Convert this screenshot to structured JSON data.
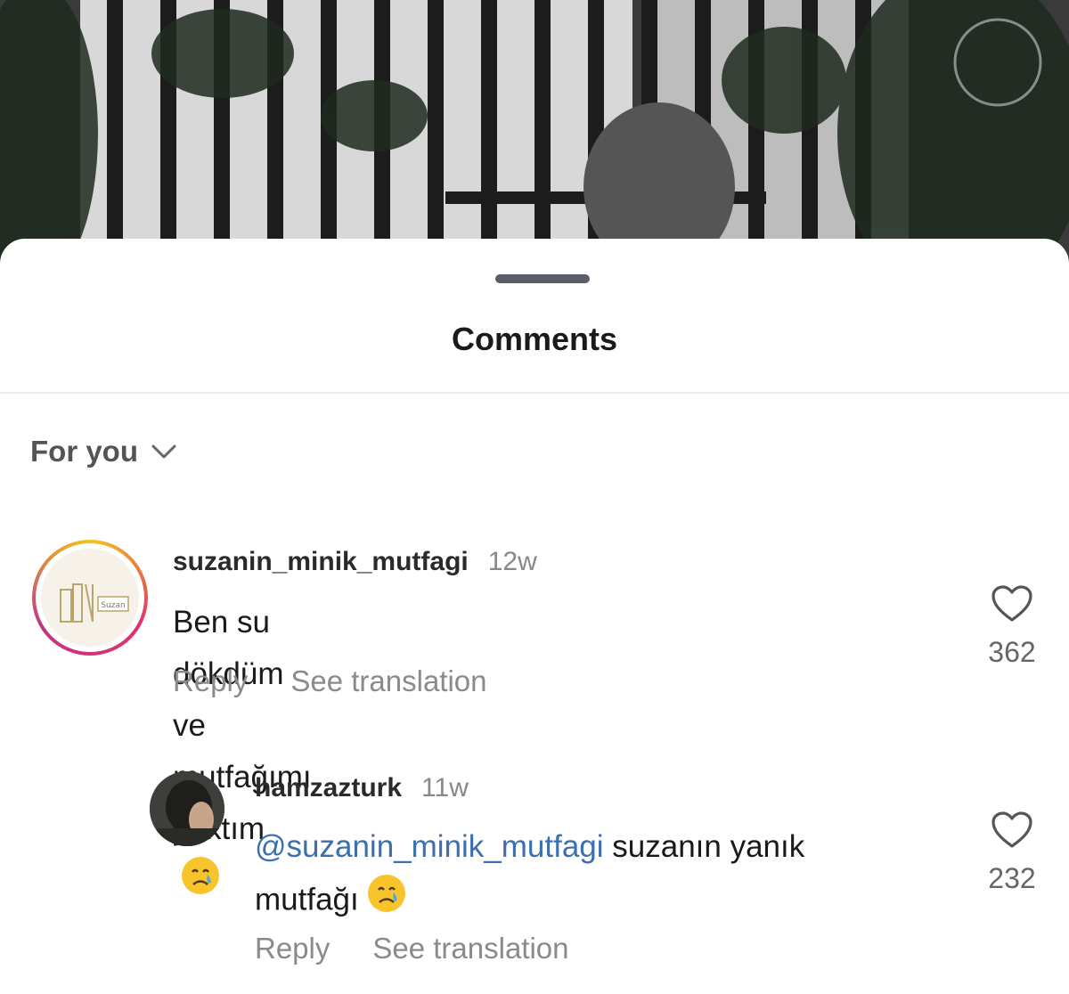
{
  "sheet": {
    "title": "Comments",
    "sort_label": "For you"
  },
  "comments": [
    {
      "username": "suzanin_minik_mutfagi",
      "time": "12w",
      "text": "Ben su dökdüm ve mutfağımı yaktım",
      "emoji": "crying-face",
      "reply_label": "Reply",
      "translate_label": "See translation",
      "likes": "362",
      "avatar_text": "Suzan"
    },
    {
      "username": "hamzazturk",
      "time": "11w",
      "mention": "@suzanin_minik_mutfagi",
      "text_line1": "suzanın yanık",
      "text_line2": "mutfağı",
      "emoji": "crying-face",
      "reply_label": "Reply",
      "translate_label": "See translation",
      "likes": "232"
    }
  ],
  "colors": {
    "mention": "#3b6fb0",
    "avatar_ring_start": "#c13584",
    "avatar_ring_end": "#f5c518"
  }
}
